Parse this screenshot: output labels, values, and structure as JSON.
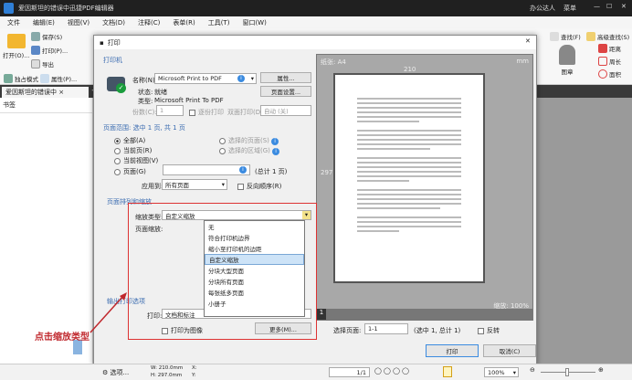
{
  "app": {
    "title": "爱因斯坦的错误中迅捷PDF编辑器",
    "user": "办公达人",
    "menu_label": "菜单"
  },
  "menu": [
    "文件",
    "编辑(E)",
    "视图(V)",
    "文档(D)",
    "注释(C)",
    "表单(R)",
    "工具(T)",
    "窗口(W)"
  ],
  "toolbar": {
    "open": "打开(O)...",
    "save": "保存(S)",
    "print": "打印(P)...",
    "export": "导出",
    "exclusive": "独占模式",
    "properties": "属性(P)...",
    "find": "查找(F)",
    "advanced_find": "高级查找(S)",
    "stamp": "图章",
    "distance": "距离",
    "perimeter": "周长",
    "area": "面积"
  },
  "tab": {
    "label": "爱因斯坦的错误中"
  },
  "sidebar": {
    "title": "书签"
  },
  "dialog": {
    "title": "打印",
    "printer_group": "打印机",
    "name_label": "名称(N):",
    "printer_name": "Microsoft Print to PDF",
    "properties_btn": "属性...",
    "page_setup_btn": "页面设置...",
    "status_label": "状态:",
    "status_value": "就绪",
    "type_label": "类型:",
    "type_value": "Microsoft Print To PDF",
    "copies_label": "份数(C):",
    "copies_value": "1",
    "collate": "逐份打印",
    "duplex_label": "双面打印(D):",
    "duplex_value": "自动 (关)",
    "range_group": "页面范围: 选中 1 页, 共 1 页",
    "all": "全部(A)",
    "current_page": "当前页(R)",
    "current_view": "当前视图(V)",
    "pages": "页面(G)",
    "selected_pages": "选择的页面(S)",
    "selected_area": "选择的区域(G)",
    "total": "(总计 1 页)",
    "apply_label": "应用到:",
    "apply_value": "所有页面",
    "reverse": "反向顺序(R)",
    "scale_group": "页面排列和缩放",
    "scale_type_label": "缩放类型:",
    "scale_type_value": "自定义缩放",
    "page_scale_label": "页面缩放:",
    "scale_options": [
      "无",
      "符合打印机边界",
      "缩小至打印机的边距",
      "自定义缩放",
      "分块大型页面",
      "分块所有页面",
      "每张纸多页面",
      "小册子"
    ],
    "output_group": "输出打印选项",
    "print_label": "打印:",
    "print_value": "文档和标注",
    "print_as_image": "打印为图像",
    "more_btn": "更多(M)...",
    "preview": {
      "paper": "纸张: A4",
      "unit": "mm",
      "width": "210",
      "height": "297",
      "scale": "缩放: 100%",
      "page_num": "1"
    },
    "select_pages_label": "选择页面:",
    "select_pages_value": "1-1",
    "select_info": "(选中 1, 总计 1)",
    "invert": "反转",
    "print_btn": "打印",
    "cancel_btn": "取消(C)"
  },
  "annotation": "点击缩放类型",
  "status": {
    "options": "选项...",
    "w": "W: 210.0mm",
    "h": "H: 297.0mm",
    "x": "X:",
    "y": "Y:",
    "page": "1/1",
    "zoom": "100%"
  },
  "colors": {
    "accent": "#3b8be0",
    "annotation": "#c0282d",
    "highlight": "#cde3f7"
  }
}
